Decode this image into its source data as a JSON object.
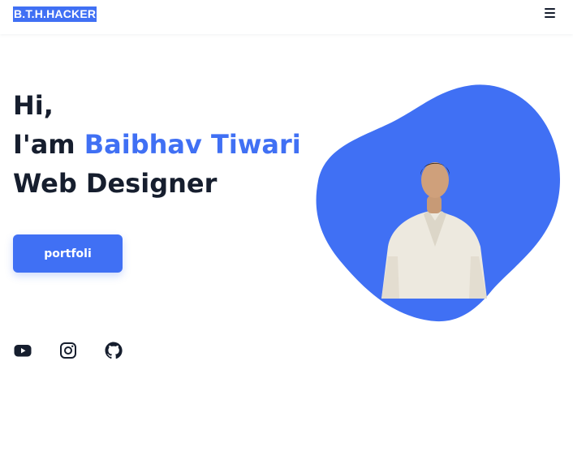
{
  "header": {
    "logo": "B.T.H.HACKER",
    "menu_icon": "hamburger-menu-icon"
  },
  "hero": {
    "greeting": "Hi,",
    "intro_prefix": "I'am",
    "name": "Baibhav Tiwari",
    "role": "Web Designer",
    "cta_label": "portfoli"
  },
  "social": [
    {
      "icon": "youtube-icon"
    },
    {
      "icon": "instagram-icon"
    },
    {
      "icon": "github-icon"
    }
  ],
  "colors": {
    "accent": "#4070f4",
    "text": "#161e2e",
    "background": "#ffffff"
  }
}
